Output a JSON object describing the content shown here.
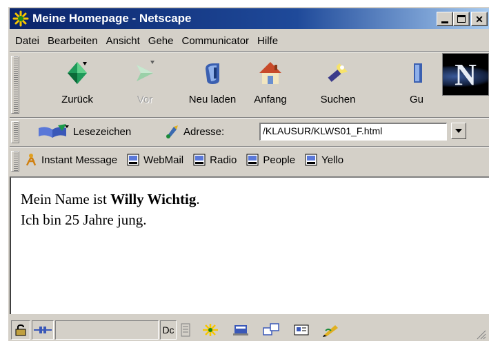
{
  "window": {
    "title": "Meine Homepage - Netscape",
    "title_bg": "#0a246a",
    "chrome_bg": "#d4d0c8"
  },
  "menubar": {
    "items": [
      "Datei",
      "Bearbeiten",
      "Ansicht",
      "Gehe",
      "Communicator",
      "Hilfe"
    ]
  },
  "navigation": {
    "buttons": [
      {
        "label": "Zurück",
        "icon": "back-arrow-icon",
        "enabled": true
      },
      {
        "label": "Vor",
        "icon": "forward-arrow-icon",
        "enabled": false
      },
      {
        "label": "Neu laden",
        "icon": "reload-icon",
        "enabled": true
      },
      {
        "label": "Anfang",
        "icon": "home-icon",
        "enabled": true
      },
      {
        "label": "Suchen",
        "icon": "search-flashlight-icon",
        "enabled": true
      },
      {
        "label": "Gu",
        "icon": "guide-icon",
        "enabled": true
      }
    ],
    "logo": "N"
  },
  "location": {
    "bookmarks_label": "Lesezeichen",
    "address_label": "Adresse:",
    "address_value": "/KLAUSUR/KLWS01_F.html"
  },
  "personal_toolbar": {
    "items": [
      "Instant Message",
      "WebMail",
      "Radio",
      "People",
      "Yello"
    ]
  },
  "content": {
    "line1_prefix": "Mein Name ist ",
    "line1_bold": "Willy Wichtig",
    "line1_suffix": ".",
    "line2": "Ich bin 25 Jahre jung."
  },
  "statusbar": {
    "doc_text": "Dc"
  }
}
